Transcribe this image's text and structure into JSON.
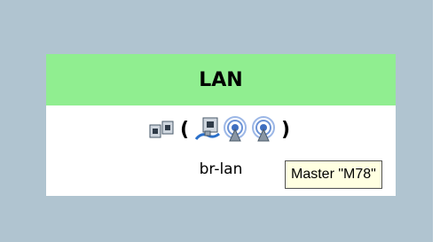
{
  "network": {
    "name": "LAN",
    "device": "br-lan",
    "header_color": "#90ee90",
    "interfaces": [
      {
        "icon": "ethernet-ports-icon"
      },
      {
        "icon": "ethernet-cable-icon"
      },
      {
        "icon": "wifi-icon"
      },
      {
        "icon": "wifi-icon"
      }
    ],
    "paren_open": "(",
    "paren_close": ")"
  },
  "tooltip": {
    "text": "Master \"M78\""
  }
}
